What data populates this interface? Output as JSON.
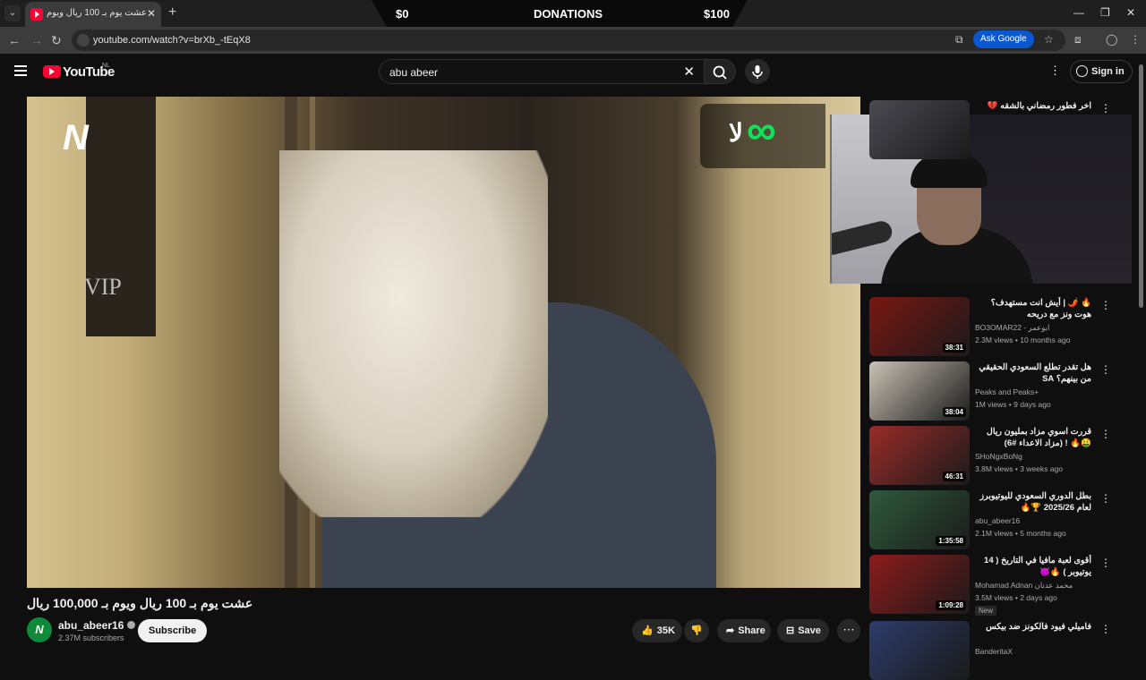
{
  "browser": {
    "tab_title": "عشت يوم بـ 100 ريال ويوم بـ 100,000",
    "url": "youtube.com/watch?v=brXb_-tEqX8",
    "ask_google": "Ask Google"
  },
  "stream_overlay": {
    "left": "$0",
    "center": "DONATIONS",
    "right": "$100"
  },
  "youtube": {
    "logo_text": "YouTube",
    "country_code": "NL",
    "search_value": "abu abeer",
    "sign_in": "Sign in"
  },
  "video": {
    "title": "عشت يوم بـ 100 ريال ويوم بـ 100,000 ريال",
    "door_sign": "VIP",
    "channel_name": "abu_abeer16",
    "subscribers": "2.37M subscribers",
    "subscribe_label": "Subscribe",
    "likes": "35K",
    "share_label": "Share",
    "save_label": "Save"
  },
  "recommendations": [
    {
      "title": "اخر فطور رمضاني بالشقه 💔",
      "channel": "",
      "meta": "",
      "duration": "",
      "thumb_color": "#4b4a52"
    },
    {
      "title": "🔥 🌶️ | أيش انت مستهدف؟ هوت ونز مع دريحه",
      "channel": "BO3OMAR22 - ابوعمر",
      "meta": "2.3M views • 10 months ago",
      "duration": "38:31",
      "thumb_color": "#7a1712"
    },
    {
      "title": "هل تقدر تطلع السعودي الحقيقي من بينهم؟ SA",
      "channel": "Peaks and Peaks+",
      "meta": "1M views • 9 days ago",
      "duration": "38:04",
      "thumb_color": "#c9c2b5"
    },
    {
      "title": "قررت اسوي مزاد بمليون ريال 🤑🔥 ! (مزاد الاعداء #6)",
      "channel": "SHoNgxBoNg",
      "meta": "3.8M views • 3 weeks ago",
      "duration": "46:31",
      "thumb_color": "#9a2c29"
    },
    {
      "title": "بطل الدوري السعودي لليوتيوبرز لعام 2025/26 🏆🔥",
      "channel": "abu_abeer16",
      "meta": "2.1M views • 5 months ago",
      "duration": "1:35:58",
      "thumb_color": "#2f5a3c"
    },
    {
      "title": "أقوى لعبة مافيا في التاريخ ( 14 يوتيوبر ) 🔥😈",
      "channel": "Mohamad Adnan محمد عدنان",
      "meta": "3.5M views • 2 days ago",
      "duration": "1:09:28",
      "badge": "New",
      "thumb_color": "#8e1b1b"
    },
    {
      "title": "فاميلي فيود فالكونز ضد بيكس",
      "channel": "BanderitaX",
      "meta": "",
      "duration": "",
      "thumb_color": "#2d3c6b"
    }
  ]
}
